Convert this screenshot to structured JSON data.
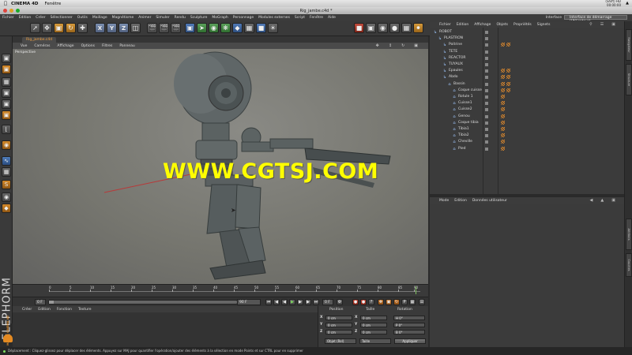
{
  "os": {
    "app_name": "CINEMA 4D",
    "menu": [
      "Fenêtre"
    ],
    "clock_line1": "(Shift) HD",
    "clock_line2": "00:00:00"
  },
  "window": {
    "title": "Rig_jambe.c4d *"
  },
  "menubar": {
    "items": [
      "Fichier",
      "Edition",
      "Créer",
      "Sélectionner",
      "Outils",
      "Maillage",
      "Magnétisme",
      "Animer",
      "Simuler",
      "Rendu",
      "Sculpture",
      "MoGraph",
      "Personnage",
      "Modules externes",
      "Script",
      "Fenêtre",
      "Aide"
    ],
    "interface_label": "Interface",
    "interface_value": "Interface de démarrage (Utilisateur)"
  },
  "toolbar": {
    "x_label": "X",
    "y_label": "Y",
    "z_label": "Z"
  },
  "viewport": {
    "tab_label": "Rig_jambe.c4d",
    "menu": [
      "Vue",
      "Caméras",
      "Affichage",
      "Options",
      "Filtres",
      "Panneau"
    ],
    "camera_label": "Perspective",
    "watermark": "WWW.CGTSJ.COM"
  },
  "branding": {
    "elephorm": "ELEPHORM",
    "maxon": "MAXON CINEMA 4D"
  },
  "timeline": {
    "ticks": [
      "0",
      "5",
      "10",
      "15",
      "20",
      "25",
      "30",
      "35",
      "40",
      "45",
      "50",
      "55",
      "60",
      "65",
      "70",
      "75",
      "80",
      "85",
      "90"
    ],
    "start_frame": "0 F",
    "current_frame": "90 F",
    "end_frame": "0 F"
  },
  "materials": {
    "menu": [
      "Créer",
      "Edition",
      "Fonction",
      "Texture"
    ]
  },
  "coords": {
    "headers": [
      "Position",
      "Taille",
      "Rotation"
    ],
    "rows": [
      {
        "axis": "X",
        "p": "0 cm",
        "s": "0 cm",
        "r": "H 0°"
      },
      {
        "axis": "Y",
        "p": "0 cm",
        "s": "0 cm",
        "r": "P 0°"
      },
      {
        "axis": "Z",
        "p": "0 cm",
        "s": "0 cm",
        "r": "B 0°"
      }
    ],
    "mode_select": "Objet (Rel)",
    "size_select": "Taille",
    "apply_label": "Appliquer"
  },
  "status": {
    "text": "Déplacement : Cliquez-glissez pour déplacer des éléments. Appuyez sur MAJ pour quantifier l'opération/ajouter des éléments à la sélection en mode Points et sur CTRL pour en supprimer"
  },
  "object_manager": {
    "menu": [
      "Fichier",
      "Edition",
      "Affichage",
      "Objets",
      "Propriétés",
      "Signets"
    ],
    "rows": [
      {
        "name": "ROBOT",
        "level": 0,
        "icon": "null-icon",
        "tags": 0
      },
      {
        "name": "PLASTRON",
        "level": 1,
        "icon": "null-icon",
        "tags": 0
      },
      {
        "name": "Poitrine",
        "level": 2,
        "icon": "null-icon",
        "tags": 2
      },
      {
        "name": "TETE",
        "level": 2,
        "icon": "null-icon",
        "tags": 0
      },
      {
        "name": "REACTOR",
        "level": 2,
        "icon": "null-icon",
        "tags": 0
      },
      {
        "name": "TUYAUX",
        "level": 2,
        "icon": "null-icon",
        "tags": 0
      },
      {
        "name": "Epaules",
        "level": 2,
        "icon": "null-icon",
        "tags": 2
      },
      {
        "name": "Abdo",
        "level": 2,
        "icon": "null-icon",
        "tags": 2
      },
      {
        "name": "Bassin",
        "level": 3,
        "icon": "joint-icon",
        "tags": 2
      },
      {
        "name": "Coque cuisse",
        "level": 4,
        "icon": "joint-icon",
        "tags": 2
      },
      {
        "name": "Rotule 1",
        "level": 4,
        "icon": "joint-icon",
        "tags": 1
      },
      {
        "name": "Cuisse1",
        "level": 4,
        "icon": "joint-icon",
        "tags": 1
      },
      {
        "name": "Cuisse2",
        "level": 4,
        "icon": "joint-icon",
        "tags": 1
      },
      {
        "name": "Genou",
        "level": 4,
        "icon": "joint-icon",
        "tags": 1
      },
      {
        "name": "Coque tibia",
        "level": 4,
        "icon": "joint-icon",
        "tags": 1
      },
      {
        "name": "Tibia1",
        "level": 4,
        "icon": "joint-icon",
        "tags": 1
      },
      {
        "name": "Tibia2",
        "level": 4,
        "icon": "joint-icon",
        "tags": 1
      },
      {
        "name": "Cheville",
        "level": 4,
        "icon": "joint-icon",
        "tags": 1
      },
      {
        "name": "Pied",
        "level": 4,
        "icon": "joint-icon",
        "tags": 1
      }
    ]
  },
  "attribute_manager": {
    "menu": [
      "Mode",
      "Edition",
      "Données utilisateur"
    ]
  },
  "side_tabs": [
    "Navigateur",
    "Structure",
    "Attributs",
    "Couches"
  ],
  "colors": {
    "watermark": "#ffff00",
    "accent_orange": "#e08a2c",
    "selection": "#4b5a6e"
  }
}
